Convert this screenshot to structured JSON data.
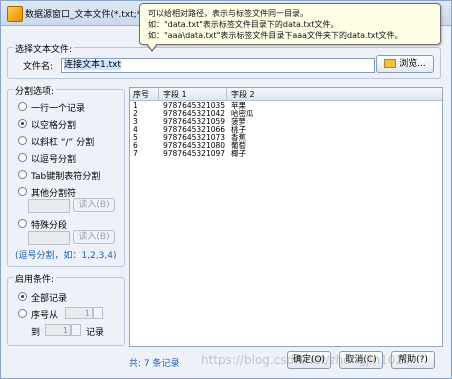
{
  "window": {
    "title": "数据源窗口_文本文件(*.txt;*.c"
  },
  "tooltip": {
    "line1": "可以给相对路径，表示与标签文件同一目录。",
    "line2": "如：\"data.txt\"表示标签文件目录下的data.txt文件。",
    "line3": "如：\"aaa\\data.txt\"表示标签文件目录下aaa文件夹下的data.txt文件。"
  },
  "file_group": {
    "legend": "选择文本文件:",
    "filename_label": "文件名:",
    "filename_value": "连接文本1.txt",
    "browse_label": "浏览..."
  },
  "split_group": {
    "legend": "分割选项:",
    "options": [
      {
        "label": "一行一个记录",
        "selected": false
      },
      {
        "label": "以空格分割",
        "selected": true
      },
      {
        "label": "以斜杠 “/” 分割",
        "selected": false
      },
      {
        "label": "以逗号分割",
        "selected": false
      },
      {
        "label": "Tab键制表符分割",
        "selected": false
      },
      {
        "label": "其他分割符",
        "selected": false
      }
    ],
    "read_in_1": "读入(B)",
    "special_label": "特殊分段",
    "read_in_2": "读入(B)",
    "hint": "(逗号分割，如：1,2,3,4)"
  },
  "condition_group": {
    "legend": "启用条件:",
    "all_records": "全部记录",
    "seq_from": "序号从",
    "from_value": "1",
    "to_label": "到",
    "to_value": "1",
    "record_label": "记录"
  },
  "grid": {
    "columns": [
      "序号",
      "字段 1",
      "字段 2"
    ],
    "rows": [
      [
        "1",
        "9787645321035",
        "苹果"
      ],
      [
        "2",
        "9787645321042",
        "哈密瓜"
      ],
      [
        "3",
        "9787645321059",
        "菠萝"
      ],
      [
        "4",
        "9787645321066",
        "桃子"
      ],
      [
        "5",
        "9787645321073",
        "香蕉"
      ],
      [
        "6",
        "9787645321080",
        "葡萄"
      ],
      [
        "7",
        "9787645321097",
        "椰子"
      ]
    ]
  },
  "footer": {
    "count_text": "共: 7 条记录",
    "ok": "确定(O)",
    "cancel": "取消(C)",
    "help": "帮助(?)",
    "watermark": "https://blog.csdn.net/zhongjin1020"
  }
}
